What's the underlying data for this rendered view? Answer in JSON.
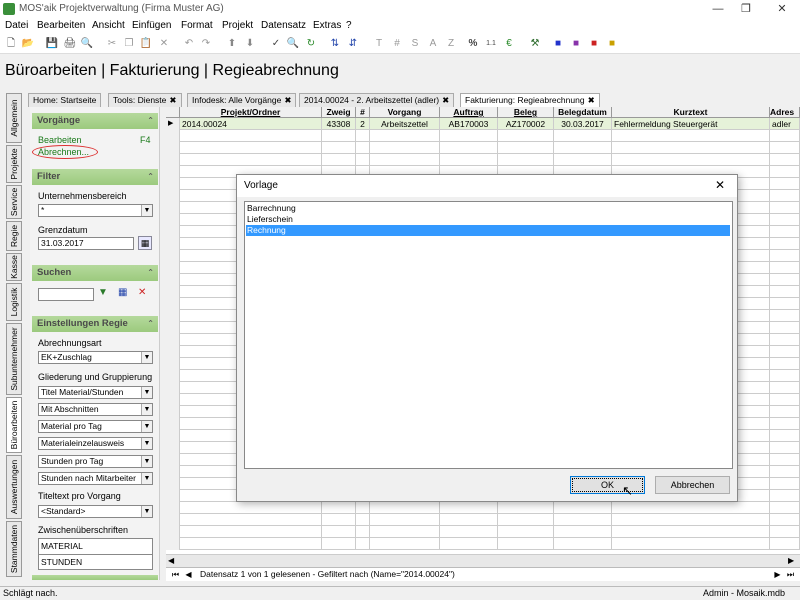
{
  "window": {
    "title": "MOS'aik Projektverwaltung (Firma Muster AG)"
  },
  "menu": [
    "Datei",
    "Bearbeiten",
    "Ansicht",
    "Einfügen",
    "Format",
    "Projekt",
    "Datensatz",
    "Extras",
    "?"
  ],
  "toolbar": {
    "icons": [
      "new-icon",
      "open-icon",
      "save-icon",
      "print-icon",
      "print-preview-icon",
      "cut-icon",
      "copy-icon",
      "paste-icon",
      "delete-icon",
      "undo-icon",
      "redo-icon",
      "up-icon",
      "down-icon",
      "filter-icon",
      "search-icon",
      "refresh-icon",
      "sort-icon",
      "sort-desc-icon",
      "text-icon",
      "hash-icon",
      "s-icon",
      "a-icon",
      "z-icon",
      "percent-icon",
      "decimal-icon",
      "currency-icon",
      "tools-icon",
      "lock-blue-icon",
      "lock-purple-icon",
      "lock-red-icon",
      "folder-icon"
    ]
  },
  "heading": "Büroarbeiten | Fakturierung | Regieabrechnung",
  "tabs": [
    {
      "label": "Home: Startseite",
      "closable": false
    },
    {
      "label": "Tools: Dienste",
      "closable": true
    },
    {
      "label": "Infodesk: Alle Vorgänge",
      "closable": true
    },
    {
      "label": "2014.00024 - 2. Arbeitszettel (adler)",
      "closable": true
    },
    {
      "label": "Fakturierung: Regieabrechnung",
      "closable": true,
      "active": true
    }
  ],
  "vtabs": [
    "Allgemein",
    "Projekte",
    "Service",
    "Regie",
    "Kasse",
    "Logistik",
    "Subunternehmer",
    "Büroarbeiten",
    "Auswertungen",
    "Stammdaten"
  ],
  "vorgaenge": {
    "title": "Vorgänge",
    "bearbeiten": "Bearbeiten",
    "shortcut": "F4",
    "abrechnen": "Abrechnen..."
  },
  "filter": {
    "title": "Filter",
    "unternehmensbereich_label": "Unternehmensbereich",
    "unternehmensbereich": "*",
    "grenzdatum_label": "Grenzdatum",
    "grenzdatum": "31.03.2017"
  },
  "suchen": {
    "title": "Suchen",
    "value": ""
  },
  "einstellungen": {
    "title": "Einstellungen Regie",
    "abrechnungsart_label": "Abrechnungsart",
    "abrechnungsart": "EK+Zuschlag",
    "gliederung_label": "Gliederung und Gruppierung",
    "gliederung": [
      "Titel Material/Stunden",
      "Mit Abschnitten",
      "Material pro Tag",
      "Materialeinzelausweis",
      "Stunden pro Tag",
      "Stunden nach Mitarbeiter"
    ],
    "titeltext_label": "Titeltext pro Vorgang",
    "titeltext": "<Standard>",
    "zwischen_label": "Zwischenüberschriften",
    "zwischen": [
      "MATERIAL",
      "STUNDEN"
    ]
  },
  "grid": {
    "columns": [
      "Projekt/Ordner",
      "Zweig",
      "#",
      "Vorgang",
      "Auftrag",
      "Beleg",
      "Belegdatum",
      "Kurztext",
      "Adres"
    ],
    "rows": [
      [
        "2014.00024",
        "43308",
        "2",
        "Arbeitszettel",
        "AB170003",
        "AZ170002",
        "30.03.2017",
        "Fehlermeldung Steuergerät",
        "adler"
      ]
    ]
  },
  "navbar": {
    "text": "Datensatz 1 von 1 gelesenen - Gefiltert nach (Name=\"2014.00024\")"
  },
  "status": {
    "left": "Schlägt nach.",
    "right": "Admin - Mosaik.mdb"
  },
  "dialog": {
    "title": "Vorlage",
    "items": [
      "Barrechnung",
      "Lieferschein",
      "Rechnung"
    ],
    "selected": 2,
    "ok": "OK",
    "cancel": "Abbrechen"
  },
  "colors": {
    "accent": "#9cca7e",
    "selection": "#3399ff",
    "highlight_row": "#e6f2d9"
  }
}
